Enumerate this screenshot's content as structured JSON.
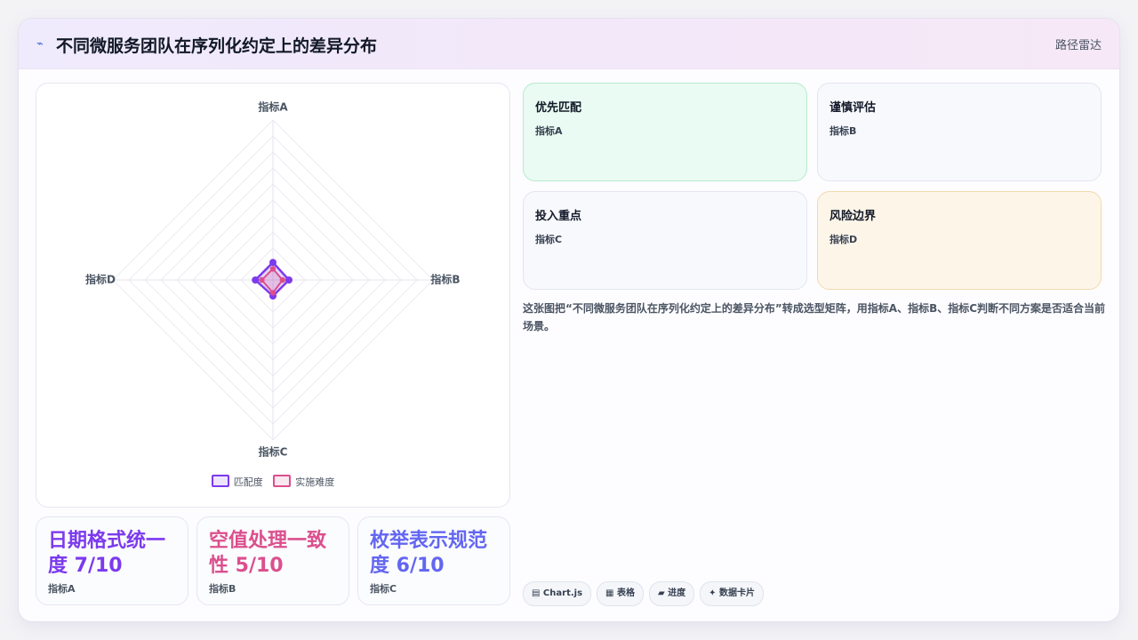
{
  "header": {
    "logo_glyph": "⌁",
    "title": "不同微服务团队在序列化约定上的差异分布",
    "tag": "路径雷达"
  },
  "chart_data": {
    "type": "radar",
    "axes": [
      "指标A",
      "指标B",
      "指标C",
      "指标D"
    ],
    "r_range": [
      0,
      10
    ],
    "grid_levels": 10,
    "series": [
      {
        "name": "匹配度",
        "values": [
          1.1,
          1.0,
          1.0,
          1.1
        ],
        "color": "#7c3aed"
      },
      {
        "name": "实施难度",
        "values": [
          0.7,
          0.6,
          0.8,
          0.7
        ],
        "color": "#db4f8d"
      }
    ],
    "legend_position": "bottom"
  },
  "stats": [
    {
      "text": "日期格式统一度 7/10",
      "sub": "指标A",
      "color": "#7c3aed"
    },
    {
      "text": "空值处理一致性 5/10",
      "sub": "指标B",
      "color": "#db4f8d"
    },
    {
      "text": "枚举表示规范度 6/10",
      "sub": "指标C",
      "color": "#6366f1"
    }
  ],
  "quadrants": [
    {
      "title": "优先匹配",
      "sub": "指标A",
      "bg": "#e9fbf2",
      "border": "#b7ead0"
    },
    {
      "title": "谨慎评估",
      "sub": "指标B",
      "bg": "#f8f9fd",
      "border": "#e3e6f0"
    },
    {
      "title": "投入重点",
      "sub": "指标C",
      "bg": "#f8f9fd",
      "border": "#e3e6f0"
    },
    {
      "title": "风险边界",
      "sub": "指标D",
      "bg": "#fdf5e8",
      "border": "#f3d9ae"
    }
  ],
  "description": "这张图把“不同微服务团队在序列化约定上的差异分布”转成选型矩阵，用指标A、指标B、指标C判断不同方案是否适合当前场景。",
  "chips": [
    "▤ Chart.js",
    "▦ 表格",
    "▰ 进度",
    "✦ 数据卡片"
  ]
}
